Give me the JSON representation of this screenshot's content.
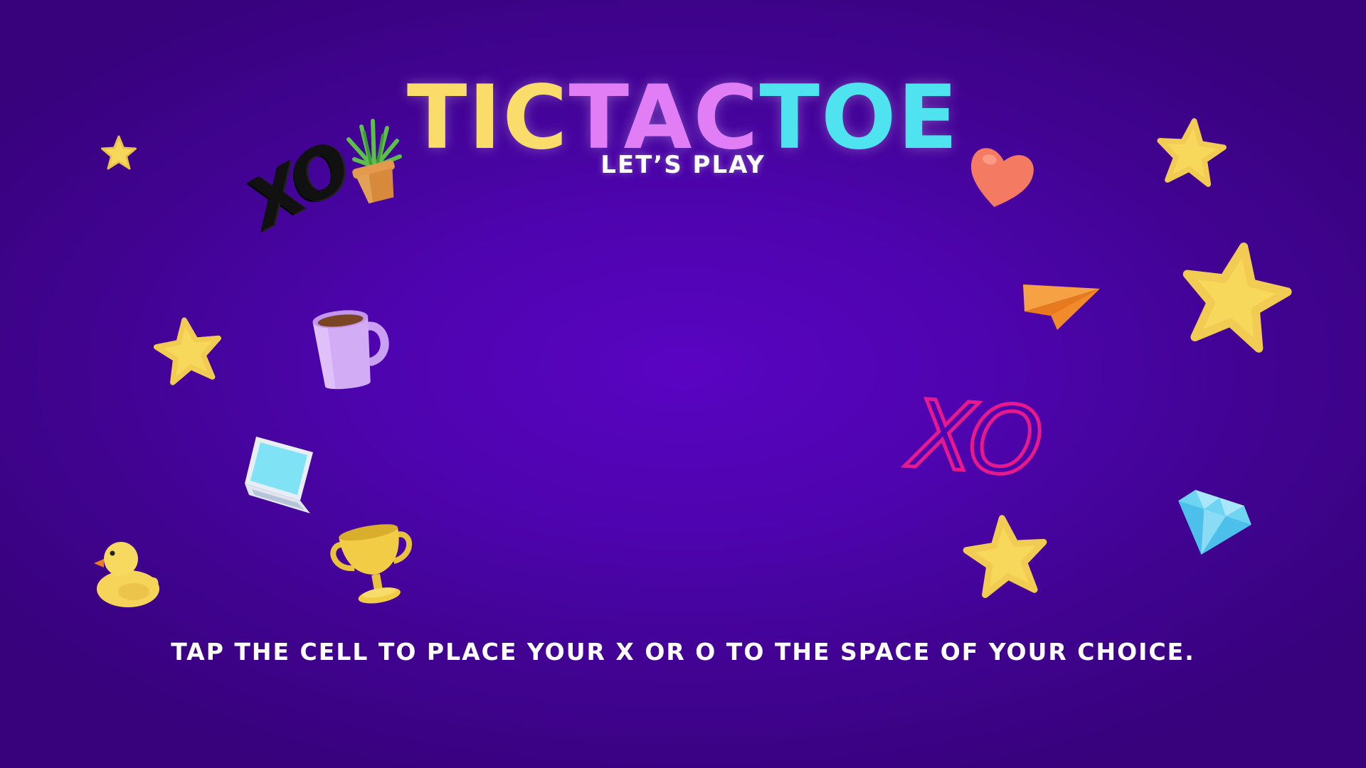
{
  "title": {
    "part1": "TIC",
    "part2": "TAC",
    "part3": "TOE",
    "colors": {
      "part1": "#fadc6a",
      "part2": "#e27ef5",
      "part3": "#4fe3f0"
    }
  },
  "subtitle": "LET’S PLAY",
  "instruction": "TAP THE CELL TO PLACE YOUR X OR O TO THE SPACE OF YOUR CHOICE.",
  "decorations": {
    "xo_black": "XO",
    "xo_pink": "XO",
    "icons": [
      "star-icon",
      "plant-pot-icon",
      "coffee-mug-icon",
      "laptop-icon",
      "rubber-duck-icon",
      "trophy-icon",
      "heart-icon",
      "paper-plane-icon",
      "diamond-icon"
    ]
  },
  "colors": {
    "background": "#4a04a8",
    "star": "#f7d85a",
    "xo_black": "#111111",
    "xo_pink": "#e8198c"
  }
}
